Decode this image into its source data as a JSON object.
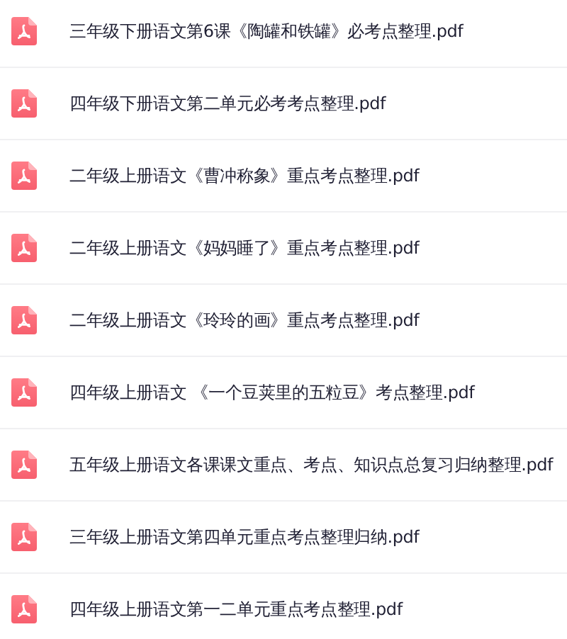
{
  "files": [
    {
      "name": "三年级下册语文第6课《陶罐和铁罐》必考点整理.pdf"
    },
    {
      "name": "四年级下册语文第二单元必考考点整理.pdf"
    },
    {
      "name": "二年级上册语文《曹冲称象》重点考点整理.pdf"
    },
    {
      "name": "二年级上册语文《妈妈睡了》重点考点整理.pdf"
    },
    {
      "name": "二年级上册语文《玲玲的画》重点考点整理.pdf"
    },
    {
      "name": "四年级上册语文 《一个豆荚里的五粒豆》考点整理.pdf"
    },
    {
      "name": "五年级上册语文各课课文重点、考点、知识点总复习归纳整理.pdf"
    },
    {
      "name": "三年级上册语文第四单元重点考点整理归纳.pdf"
    },
    {
      "name": "四年级上册语文第一二单元重点考点整理.pdf"
    }
  ]
}
